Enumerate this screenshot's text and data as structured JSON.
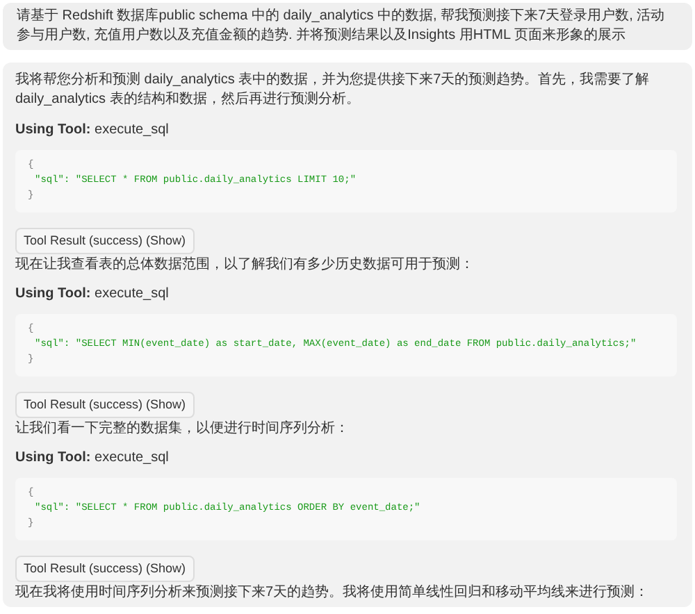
{
  "user_message": "请基于 Redshift 数据库public schema 中的 daily_analytics 中的数据, 帮我预测接下来7天登录用户数, 活动参与用户数, 充值用户数以及充值金额的趋势. 并将预测结果以及Insights 用HTML 页面来形象的展示",
  "assistant_message": {
    "intro": "我将帮您分析和预测 daily_analytics 表中的数据，并为您提供接下来7天的预测趋势。首先，我需要了解 daily_analytics 表的结构和数据，然后再进行预测分析。",
    "steps": [
      {
        "kind": "tool_call",
        "label": "Using Tool:",
        "tool": "execute_sql",
        "code_lines": [
          "{",
          "\"sql\": \"SELECT * FROM public.daily_analytics LIMIT 10;\"",
          "}"
        ]
      },
      {
        "kind": "tool_result",
        "label": "Tool Result (success) (Show)"
      },
      {
        "kind": "text",
        "text": "现在让我查看表的总体数据范围，以了解我们有多少历史数据可用于预测："
      },
      {
        "kind": "tool_call",
        "label": "Using Tool:",
        "tool": "execute_sql",
        "code_lines": [
          "{",
          "\"sql\": \"SELECT MIN(event_date) as start_date, MAX(event_date) as end_date FROM public.daily_analytics;\"",
          "}"
        ]
      },
      {
        "kind": "tool_result",
        "label": "Tool Result (success) (Show)"
      },
      {
        "kind": "text",
        "text": "让我们看一下完整的数据集，以便进行时间序列分析："
      },
      {
        "kind": "tool_call",
        "label": "Using Tool:",
        "tool": "execute_sql",
        "code_lines": [
          "{",
          "\"sql\": \"SELECT * FROM public.daily_analytics ORDER BY event_date;\"",
          "}"
        ]
      },
      {
        "kind": "tool_result",
        "label": "Tool Result (success) (Show)"
      },
      {
        "kind": "text",
        "text": "现在我将使用时间序列分析来预测接下来7天的趋势。我将使用简单线性回归和移动平均线来进行预测："
      }
    ]
  }
}
